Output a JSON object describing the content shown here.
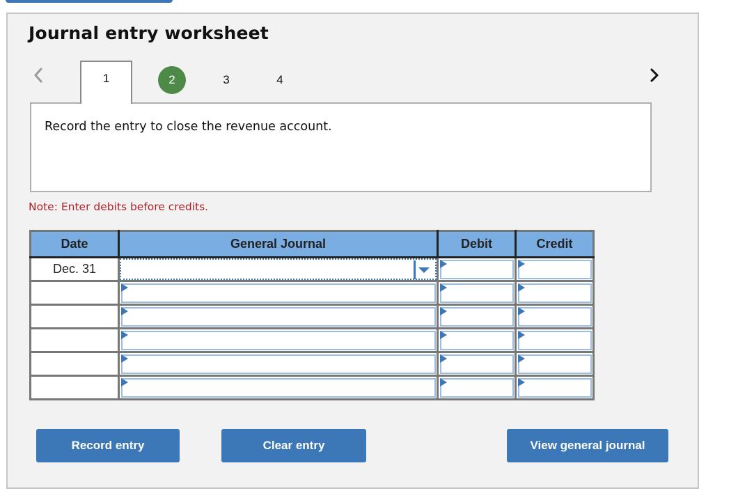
{
  "page": {
    "title": "Journal entry worksheet"
  },
  "nav": {
    "prev_icon": "chevron-left-icon",
    "next_icon": "chevron-right-icon",
    "tabs": [
      {
        "label": "1",
        "state": "selected"
      },
      {
        "label": "2",
        "state": "completed"
      },
      {
        "label": "3",
        "state": "default"
      },
      {
        "label": "4",
        "state": "default"
      }
    ]
  },
  "instruction": {
    "text": "Record the entry to close the revenue account."
  },
  "note": {
    "text": "Note: Enter debits before credits."
  },
  "journal": {
    "headers": {
      "date": "Date",
      "account": "General Journal",
      "debit": "Debit",
      "credit": "Credit"
    },
    "rows": [
      {
        "date": "Dec. 31",
        "account": "",
        "debit": "",
        "credit": ""
      },
      {
        "date": "",
        "account": "",
        "debit": "",
        "credit": ""
      },
      {
        "date": "",
        "account": "",
        "debit": "",
        "credit": ""
      },
      {
        "date": "",
        "account": "",
        "debit": "",
        "credit": ""
      },
      {
        "date": "",
        "account": "",
        "debit": "",
        "credit": ""
      },
      {
        "date": "",
        "account": "",
        "debit": "",
        "credit": ""
      }
    ]
  },
  "buttons": {
    "record": "Record entry",
    "clear": "Clear entry",
    "view": "View general journal"
  },
  "colors": {
    "accent": "#3c78b8",
    "header_bg": "#7aaee3",
    "completed_step": "#4e8a47",
    "note_text": "#b0212a",
    "panel_bg": "#f2f2f2"
  }
}
